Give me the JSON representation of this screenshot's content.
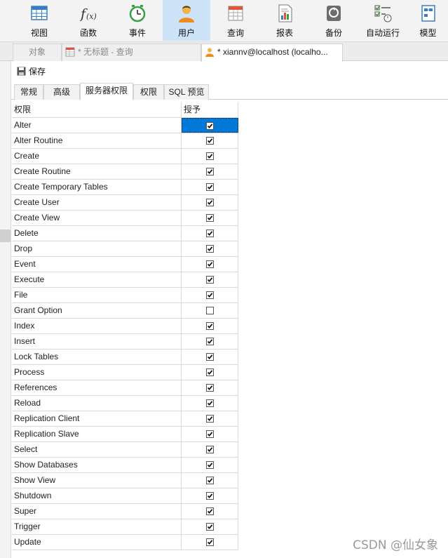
{
  "toolbar": {
    "items": [
      {
        "label": "视图",
        "icon": "table-view-icon"
      },
      {
        "label": "函数",
        "icon": "function-icon"
      },
      {
        "label": "事件",
        "icon": "clock-icon"
      },
      {
        "label": "用户",
        "icon": "user-icon"
      },
      {
        "label": "查询",
        "icon": "query-icon"
      },
      {
        "label": "报表",
        "icon": "report-icon"
      },
      {
        "label": "备份",
        "icon": "backup-icon"
      },
      {
        "label": "自动运行",
        "icon": "checklist-icon"
      },
      {
        "label": "模型",
        "icon": "model-icon"
      }
    ],
    "active": "用户"
  },
  "tabs": {
    "objects": "对象",
    "query": "* 无标题 - 查询",
    "user": "* xiannv@localhost (localho..."
  },
  "save_label": "保存",
  "subtabs": [
    "常规",
    "高级",
    "服务器权限",
    "权限",
    "SQL 预览"
  ],
  "active_subtab": "服务器权限",
  "table": {
    "col_privilege": "权限",
    "col_grant": "授予",
    "rows": [
      {
        "name": "Alter",
        "granted": true
      },
      {
        "name": "Alter Routine",
        "granted": true
      },
      {
        "name": "Create",
        "granted": true
      },
      {
        "name": "Create Routine",
        "granted": true
      },
      {
        "name": "Create Temporary Tables",
        "granted": true
      },
      {
        "name": "Create User",
        "granted": true
      },
      {
        "name": "Create View",
        "granted": true
      },
      {
        "name": "Delete",
        "granted": true
      },
      {
        "name": "Drop",
        "granted": true
      },
      {
        "name": "Event",
        "granted": true
      },
      {
        "name": "Execute",
        "granted": true
      },
      {
        "name": "File",
        "granted": true
      },
      {
        "name": "Grant Option",
        "granted": false
      },
      {
        "name": "Index",
        "granted": true
      },
      {
        "name": "Insert",
        "granted": true
      },
      {
        "name": "Lock Tables",
        "granted": true
      },
      {
        "name": "Process",
        "granted": true
      },
      {
        "name": "References",
        "granted": true
      },
      {
        "name": "Reload",
        "granted": true
      },
      {
        "name": "Replication Client",
        "granted": true
      },
      {
        "name": "Replication Slave",
        "granted": true
      },
      {
        "name": "Select",
        "granted": true
      },
      {
        "name": "Show Databases",
        "granted": true
      },
      {
        "name": "Show View",
        "granted": true
      },
      {
        "name": "Shutdown",
        "granted": true
      },
      {
        "name": "Super",
        "granted": true
      },
      {
        "name": "Trigger",
        "granted": true
      },
      {
        "name": "Update",
        "granted": true
      }
    ]
  },
  "watermark": "CSDN @仙女象",
  "colors": {
    "selected": "#0078d7",
    "active_tool": "#cde3f7"
  }
}
